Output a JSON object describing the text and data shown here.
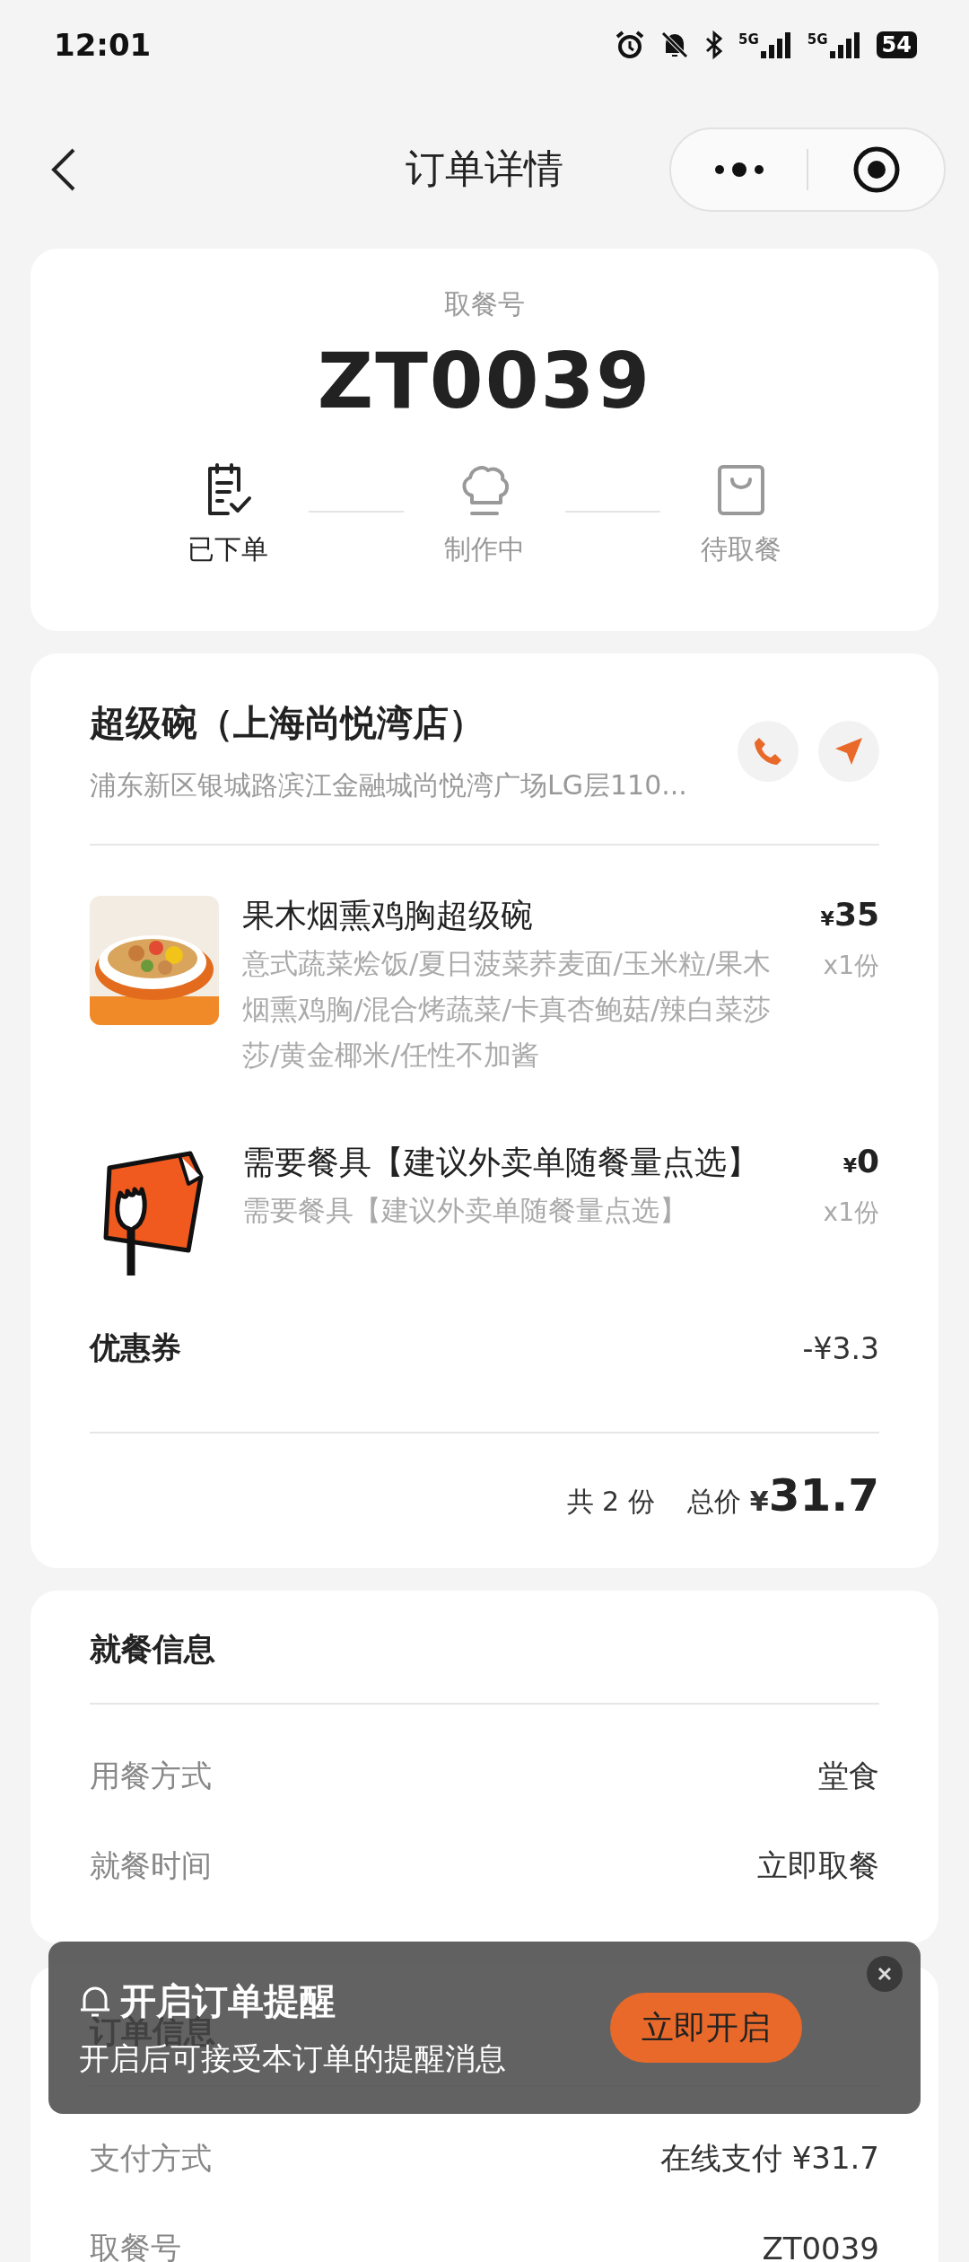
{
  "status_bar": {
    "time": "12:01",
    "signals": [
      {
        "label": "5G"
      },
      {
        "label": "5G"
      }
    ],
    "battery": "54"
  },
  "nav": {
    "title": "订单详情"
  },
  "pickup": {
    "label": "取餐号",
    "code": "ZT0039",
    "steps": [
      {
        "label": "已下单",
        "active": true
      },
      {
        "label": "制作中",
        "active": false
      },
      {
        "label": "待取餐",
        "active": false
      }
    ]
  },
  "store": {
    "name": "超级碗（上海尚悦湾店）",
    "address": "浦东新区银城路滨江金融城尚悦湾广场LG层110..."
  },
  "items": [
    {
      "name": "果木烟熏鸡胸超级碗",
      "description": "意式蔬菜烩饭/夏日菠菜荞麦面/玉米粒/果木烟熏鸡胸/混合烤蔬菜/卡真杏鲍菇/辣白菜莎莎/黄金椰米/任性不加酱",
      "currency": "¥",
      "price": "35",
      "quantity": "x1份"
    },
    {
      "kind": "utensils",
      "name": "需要餐具【建议外卖单随餐量点选】",
      "description": "需要餐具【建议外卖单随餐量点选】",
      "currency": "¥",
      "price": "0",
      "quantity": "x1份"
    }
  ],
  "coupon": {
    "label": "优惠券",
    "amount": "-¥3.3"
  },
  "total": {
    "count": "共 2 份",
    "label": "总价",
    "currency": "¥",
    "amount": "31.7"
  },
  "dining_info": {
    "title": "就餐信息",
    "rows": [
      {
        "label": "用餐方式",
        "value": "堂食"
      },
      {
        "label": "就餐时间",
        "value": "立即取餐"
      }
    ]
  },
  "order_info": {
    "title": "订单信息",
    "rows": [
      {
        "label": "支付方式",
        "value": "在线支付 ¥31.7"
      },
      {
        "label": "取餐号",
        "value": "ZT0039"
      }
    ]
  },
  "reminder": {
    "title": "开启订单提醒",
    "subtitle": "开启后可接受本订单的提醒消息",
    "button": "立即开启"
  }
}
